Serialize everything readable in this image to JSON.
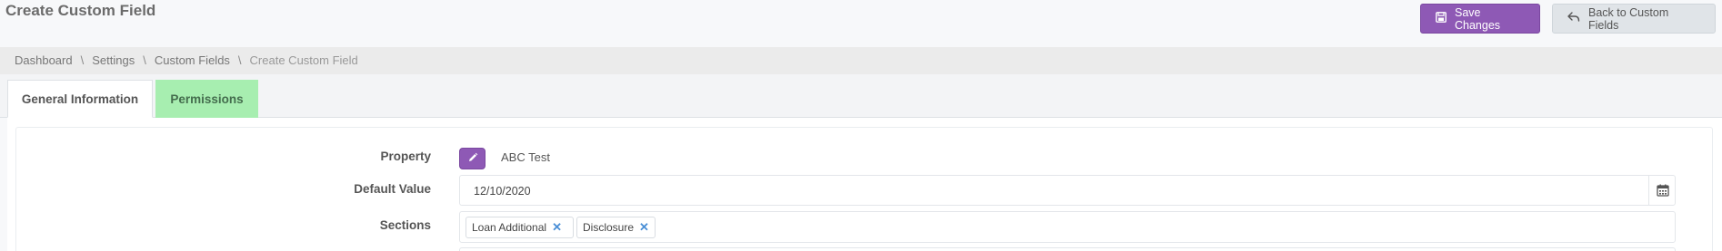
{
  "header": {
    "title": "Create Custom Field",
    "save_label": "Save Changes",
    "back_label": "Back to Custom Fields"
  },
  "breadcrumb": [
    "Dashboard",
    "Settings",
    "Custom Fields",
    "Create Custom Field"
  ],
  "tabs": [
    {
      "label": "General Information",
      "active": true
    },
    {
      "label": "Permissions",
      "active": false
    }
  ],
  "form": {
    "property_label": "Property",
    "property_value": "ABC Test",
    "default_value_label": "Default Value",
    "default_value": "12/10/2020",
    "sections_label": "Sections",
    "sections": [
      {
        "label": "Loan Additional"
      },
      {
        "label": "Disclosure"
      }
    ]
  },
  "colors": {
    "accent": "#8e59b5",
    "permissions_tab": "#a7eeb0",
    "chip_remove": "#4a8fd6"
  },
  "icons": {
    "save": "floppy-disk-icon",
    "back": "reply-arrow-icon",
    "edit": "pencil-icon",
    "calendar": "calendar-icon",
    "remove": "close-icon"
  }
}
